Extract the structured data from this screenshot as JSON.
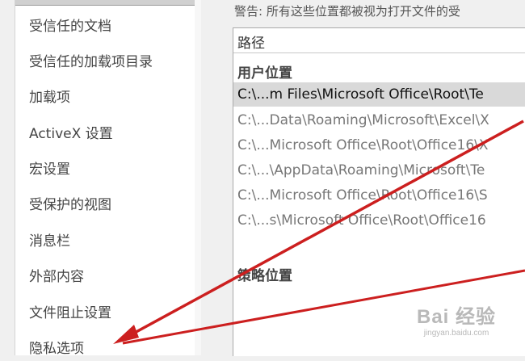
{
  "sidebar": {
    "items": [
      {
        "label": "受信任的文档"
      },
      {
        "label": "受信任的加载项目录"
      },
      {
        "label": "加载项"
      },
      {
        "label": "ActiveX 设置"
      },
      {
        "label": "宏设置"
      },
      {
        "label": "受保护的视图"
      },
      {
        "label": "消息栏"
      },
      {
        "label": "外部内容"
      },
      {
        "label": "文件阻止设置"
      },
      {
        "label": "隐私选项"
      }
    ]
  },
  "main": {
    "warning": "警告: 所有这些位置都被视为打开文件的受",
    "column_header": "路径",
    "user_section": "用户位置",
    "policy_section": "策略位置",
    "rows": [
      {
        "path": "C:\\...m Files\\Microsoft Office\\Root\\Te",
        "selected": true
      },
      {
        "path": "C:\\...Data\\Roaming\\Microsoft\\Excel\\X",
        "selected": false
      },
      {
        "path": "C:\\...Microsoft Office\\Root\\Office16\\X",
        "selected": false
      },
      {
        "path": "C:\\...\\AppData\\Roaming\\Microsoft\\Te",
        "selected": false
      },
      {
        "path": "C:\\...Microsoft Office\\Root\\Office16\\S",
        "selected": false
      },
      {
        "path": "C:\\...s\\Microsoft Office\\Root\\Office16",
        "selected": false
      }
    ]
  },
  "annotation": {
    "arrow_color": "#cc1f1f"
  },
  "watermark": {
    "main": "Bai 经验",
    "sub": "jingyan.baidu.com"
  }
}
